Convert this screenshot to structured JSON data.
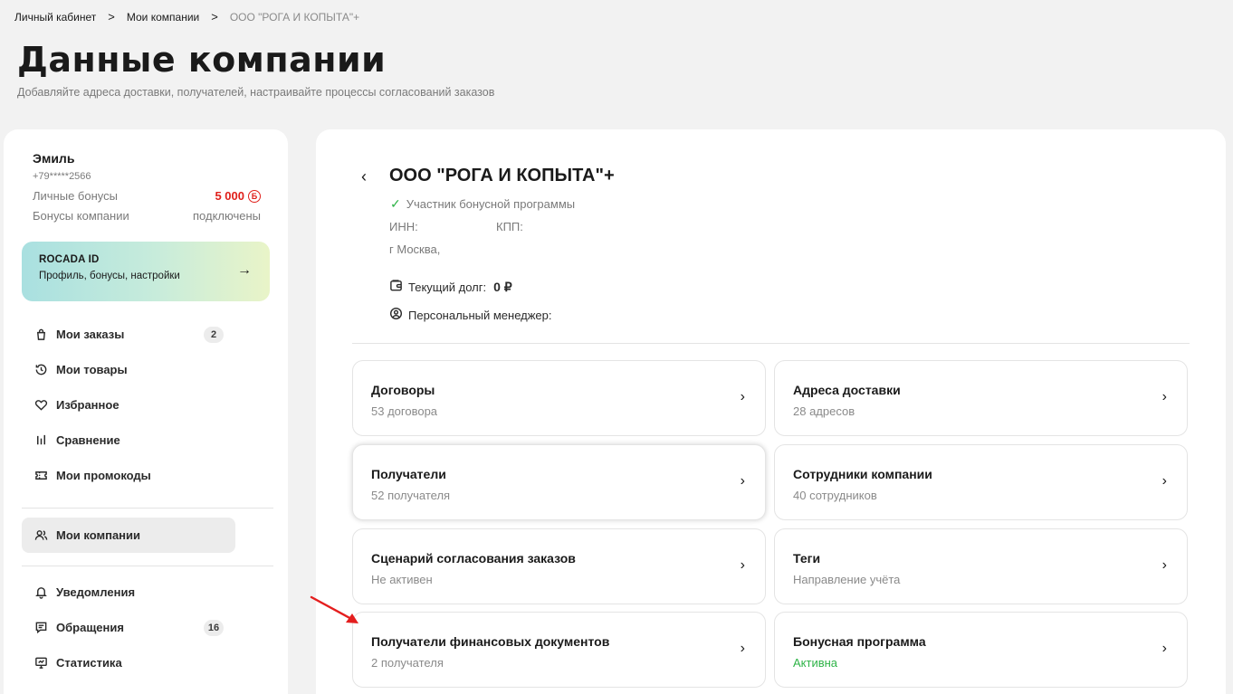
{
  "breadcrumb": {
    "items": [
      "Личный кабинет",
      "Мои компании",
      "ООО \"РОГА И КОПЫТА\"+"
    ],
    "separator": ">"
  },
  "page": {
    "title": "Данные компании",
    "subtitle": "Добавляйте адреса доставки, получателей, настраивайте процессы согласований заказов"
  },
  "sidebar": {
    "user_name": "Эмиль",
    "phone": "+79*****2566",
    "personal_bonus_label": "Личные бонусы",
    "personal_bonus_value": "5 000",
    "bonus_symbol": "Б",
    "company_bonus_label": "Бонусы компании",
    "company_bonus_value": "подключены",
    "rocada": {
      "title": "ROCADA ID",
      "subtitle": "Профиль, бонусы, настройки",
      "arrow": "→"
    },
    "menu_group1": [
      {
        "label": "Мои заказы",
        "icon": "bag-icon",
        "count": "2"
      },
      {
        "label": "Мои товары",
        "icon": "history-icon",
        "count": ""
      },
      {
        "label": "Избранное",
        "icon": "heart-icon",
        "count": ""
      },
      {
        "label": "Сравнение",
        "icon": "compare-icon",
        "count": ""
      },
      {
        "label": "Мои промокоды",
        "icon": "ticket-icon",
        "count": ""
      }
    ],
    "menu_group2": [
      {
        "label": "Мои компании",
        "icon": "users-icon",
        "count": "",
        "active": true
      }
    ],
    "menu_group3": [
      {
        "label": "Уведомления",
        "icon": "bell-icon",
        "count": ""
      },
      {
        "label": "Обращения",
        "icon": "chat-icon",
        "count": "16"
      },
      {
        "label": "Статистика",
        "icon": "monitor-icon",
        "count": ""
      }
    ]
  },
  "company": {
    "back": "‹",
    "name": "ООО \"РОГА И КОПЫТА\"+",
    "member_check": "✓",
    "member_label": "Участник бонусной программы",
    "inn_label": "ИНН:",
    "kpp_label": "КПП:",
    "city": "г Москва,",
    "debt_label": "Текущий долг:",
    "debt_value": "0 ₽",
    "manager_label": "Персональный менеджер:"
  },
  "cards": [
    {
      "title": "Договоры",
      "sub": "53 договора"
    },
    {
      "title": "Адреса доставки",
      "sub": "28 адресов"
    },
    {
      "title": "Получатели",
      "sub": "52 получателя"
    },
    {
      "title": "Сотрудники компании",
      "sub": "40 сотрудников"
    },
    {
      "title": "Сценарий согласования заказов",
      "sub": "Не активен"
    },
    {
      "title": "Теги",
      "sub": "Направление учёта"
    },
    {
      "title": "Получатели финансовых документов",
      "sub": "2 получателя"
    },
    {
      "title": "Бонусная программа",
      "sub": "Активна"
    }
  ],
  "chevron": "›",
  "colors": {
    "accent_red": "#e0201b",
    "active_green": "#2eb347",
    "annotation_arrow": "#e41e1e"
  }
}
